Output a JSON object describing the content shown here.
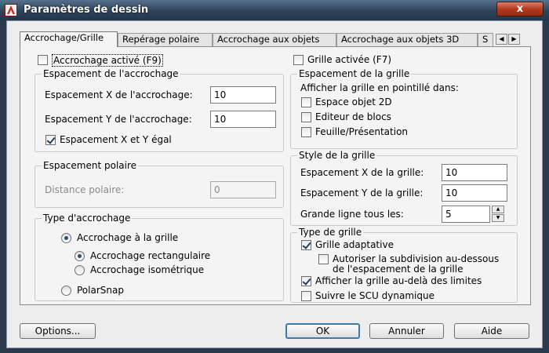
{
  "window": {
    "title": "Paramètres de dessin",
    "close_label": "x"
  },
  "tabs": [
    {
      "label": "Accrochage/Grille",
      "active": true
    },
    {
      "label": "Repérage polaire",
      "active": false
    },
    {
      "label": "Accrochage aux objets",
      "active": false
    },
    {
      "label": "Accrochage aux objets 3D",
      "active": false
    },
    {
      "label": "S",
      "active": false
    }
  ],
  "tab_scroll": {
    "left": "◀",
    "right": "▶"
  },
  "snap": {
    "enabled_label": "Accrochage activé (F9)",
    "enabled": false,
    "spacing_group": "Espacement de l'accrochage",
    "x_label": "Espacement X de l'accrochage:",
    "x_value": "10",
    "y_label": "Espacement Y de l'accrochage:",
    "y_value": "10",
    "equal_label": "Espacement X et Y égal",
    "equal_checked": true
  },
  "polar": {
    "group": "Espacement polaire",
    "distance_label": "Distance polaire:",
    "distance_value": "0"
  },
  "snap_type": {
    "group": "Type d'accrochage",
    "grid_snap": "Accrochage à la grille",
    "rectangular": "Accrochage rectangulaire",
    "isometric": "Accrochage isométrique",
    "polarsnap": "PolarSnap"
  },
  "grid": {
    "enabled_label": "Grille activée (F7)",
    "enabled": false,
    "spacing_group": "Espacement de la grille",
    "dotted_label": "Afficher la grille en pointillé dans:",
    "paper2d": "Espace objet 2D",
    "block_editor": "Editeur de blocs",
    "sheet_layout": "Feuille/Présentation"
  },
  "grid_style": {
    "group": "Style de la grille",
    "x_label": "Espacement X de la grille:",
    "x_value": "10",
    "y_label": "Espacement Y de la grille:",
    "y_value": "10",
    "major_label": "Grande ligne tous les:",
    "major_value": "5"
  },
  "grid_type": {
    "group": "Type de grille",
    "adaptive": "Grille adaptative",
    "subdivide": "Autoriser la subdivision au-dessous",
    "subdivide_2": "de l'espacement de la grille",
    "beyond_limits": "Afficher la grille au-delà des limites",
    "follow_ucs": "Suivre le SCU dynamique"
  },
  "buttons": {
    "options": "Options...",
    "ok": "OK",
    "cancel": "Annuler",
    "help": "Aide"
  },
  "colors": {
    "title_bar": "#2e435a",
    "close": "#b23a1f",
    "dialog": "#ededed",
    "focus": "#3d7bad"
  }
}
